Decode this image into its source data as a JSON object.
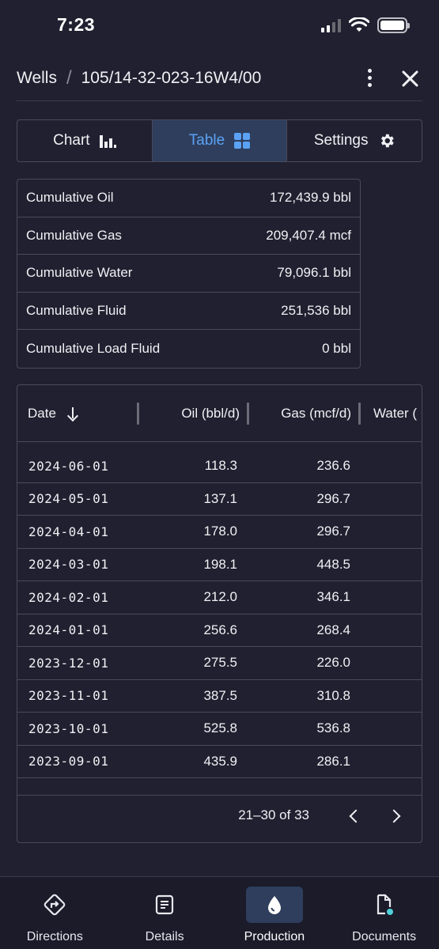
{
  "status_bar": {
    "time": "7:23"
  },
  "header": {
    "breadcrumb_root": "Wells",
    "breadcrumb_separator": "/",
    "well_id": "105/14-32-023-16W4/00"
  },
  "tabs": [
    {
      "label": "Chart",
      "icon": "bar-chart-icon",
      "active": false
    },
    {
      "label": "Table",
      "icon": "grid-icon",
      "active": true
    },
    {
      "label": "Settings",
      "icon": "gear-icon",
      "active": false
    }
  ],
  "summary": [
    {
      "label": "Cumulative Oil",
      "value": "172,439.9 bbl"
    },
    {
      "label": "Cumulative Gas",
      "value": "209,407.4 mcf"
    },
    {
      "label": "Cumulative Water",
      "value": "79,096.1 bbl"
    },
    {
      "label": "Cumulative Fluid",
      "value": "251,536 bbl"
    },
    {
      "label": "Cumulative Load Fluid",
      "value": "0 bbl"
    }
  ],
  "table": {
    "columns": [
      "Date",
      "Oil (bbl/d)",
      "Gas (mcf/d)",
      "Water ("
    ],
    "rows": [
      {
        "date": "2024-06-01",
        "oil": "118.3",
        "gas": "236.6"
      },
      {
        "date": "2024-05-01",
        "oil": "137.1",
        "gas": "296.7"
      },
      {
        "date": "2024-04-01",
        "oil": "178.0",
        "gas": "296.7"
      },
      {
        "date": "2024-03-01",
        "oil": "198.1",
        "gas": "448.5"
      },
      {
        "date": "2024-02-01",
        "oil": "212.0",
        "gas": "346.1"
      },
      {
        "date": "2024-01-01",
        "oil": "256.6",
        "gas": "268.4"
      },
      {
        "date": "2023-12-01",
        "oil": "275.5",
        "gas": "226.0"
      },
      {
        "date": "2023-11-01",
        "oil": "387.5",
        "gas": "310.8"
      },
      {
        "date": "2023-10-01",
        "oil": "525.8",
        "gas": "536.8"
      },
      {
        "date": "2023-09-01",
        "oil": "435.9",
        "gas": "286.1"
      }
    ],
    "pagination": "21–30 of 33"
  },
  "bottom_nav": [
    {
      "label": "Directions",
      "icon": "directions-icon",
      "active": false
    },
    {
      "label": "Details",
      "icon": "document-list-icon",
      "active": false
    },
    {
      "label": "Production",
      "icon": "droplet-icon",
      "active": true
    },
    {
      "label": "Documents",
      "icon": "file-icon",
      "active": false
    }
  ],
  "colors": {
    "background": "#202030",
    "accent": "#5ba2f5",
    "active_bg": "#2e3e5c",
    "border": "#4a4a5a",
    "notification_dot": "#4fd1d9"
  }
}
